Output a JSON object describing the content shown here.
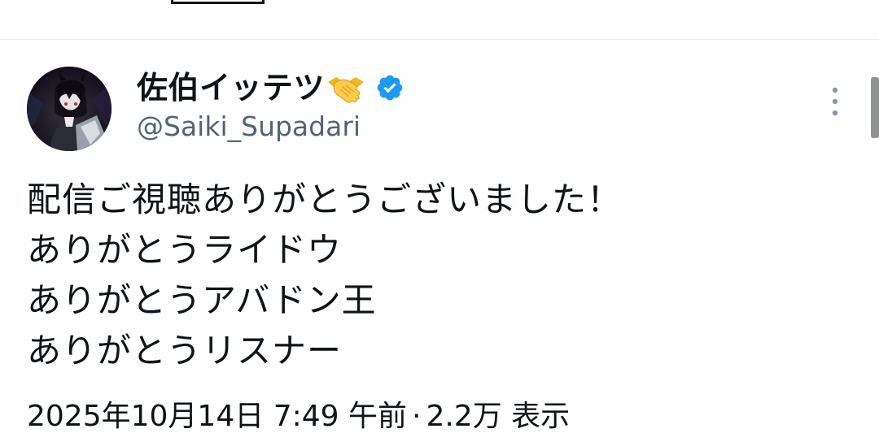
{
  "author": {
    "display_name": "佐伯イッテツ",
    "handle": "@Saiki_Supadari",
    "emoji": "handshake-emoji",
    "verified": true,
    "verified_color": "#1d9bf0"
  },
  "tweet": {
    "lines": [
      "配信ご視聴ありがとうございました！",
      "ありがとうライドウ",
      "ありがとうアバドン王",
      "ありがとうリスナー"
    ]
  },
  "meta": {
    "date": "2025年10月14日",
    "time": "7:49 午前",
    "separator": "·",
    "views": "2.2万",
    "views_label": "表示"
  },
  "icons": {
    "more": "more-vertical-icon",
    "avatar": "avatar"
  }
}
